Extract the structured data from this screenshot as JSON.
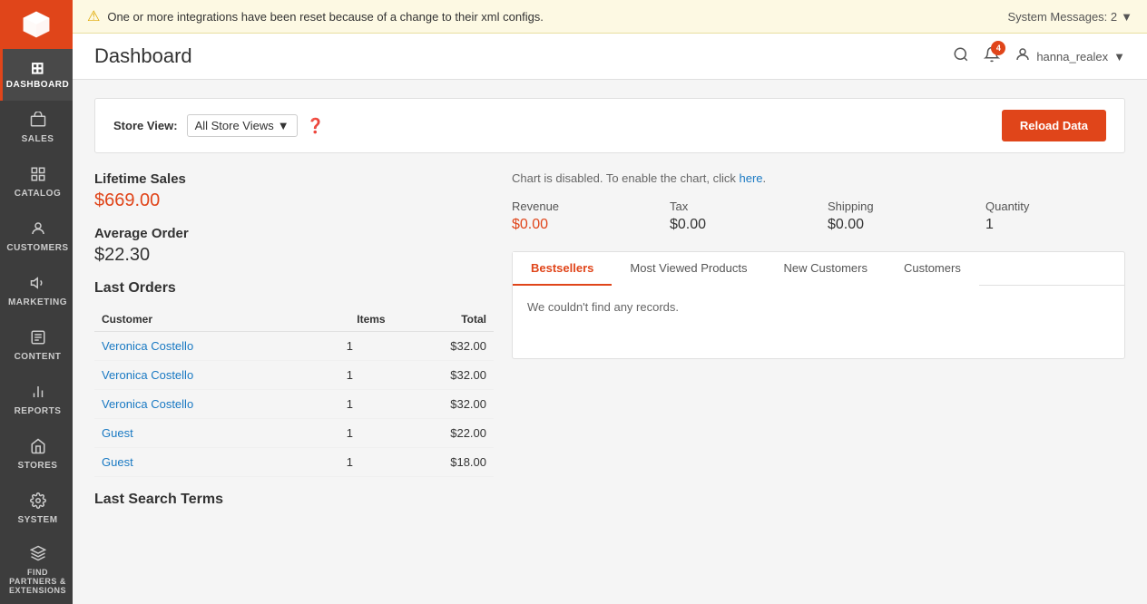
{
  "sidebar": {
    "logo_alt": "Magento Logo",
    "items": [
      {
        "id": "dashboard",
        "label": "DASHBOARD",
        "icon": "⊞",
        "active": true
      },
      {
        "id": "sales",
        "label": "SALES",
        "icon": "🏷"
      },
      {
        "id": "catalog",
        "label": "CATALOG",
        "icon": "📦"
      },
      {
        "id": "customers",
        "label": "CUSTOMERS",
        "icon": "👤"
      },
      {
        "id": "marketing",
        "label": "MARKETING",
        "icon": "📢"
      },
      {
        "id": "content",
        "label": "CONTENT",
        "icon": "📄"
      },
      {
        "id": "reports",
        "label": "REPORTS",
        "icon": "📊"
      },
      {
        "id": "stores",
        "label": "STORES",
        "icon": "🏪"
      },
      {
        "id": "system",
        "label": "SYSTEM",
        "icon": "⚙"
      },
      {
        "id": "find-partners",
        "label": "FIND PARTNERS & EXTENSIONS",
        "icon": "🔌"
      }
    ]
  },
  "alert": {
    "message_prefix": "One or more ",
    "link_text": "integrations",
    "message_suffix": " have been reset because of a change to their xml configs.",
    "system_messages_label": "System Messages: 2"
  },
  "header": {
    "title": "Dashboard",
    "notification_count": "4",
    "user_name": "hanna_realex"
  },
  "store_view": {
    "label": "Store View:",
    "selected": "All Store Views",
    "reload_button": "Reload Data"
  },
  "metrics": {
    "lifetime_sales_label": "Lifetime Sales",
    "lifetime_sales_value": "$669.00",
    "average_order_label": "Average Order",
    "average_order_value": "$22.30"
  },
  "chart": {
    "disabled_message_prefix": "Chart is disabled. To enable the chart, click ",
    "disabled_link": "here",
    "disabled_message_suffix": "."
  },
  "stats": [
    {
      "label": "Revenue",
      "value": "$0.00",
      "orange": true
    },
    {
      "label": "Tax",
      "value": "$0.00",
      "orange": false
    },
    {
      "label": "Shipping",
      "value": "$0.00",
      "orange": false
    },
    {
      "label": "Quantity",
      "value": "1",
      "orange": false
    }
  ],
  "tabs": [
    {
      "id": "bestsellers",
      "label": "Bestsellers",
      "active": true
    },
    {
      "id": "most-viewed",
      "label": "Most Viewed Products",
      "active": false
    },
    {
      "id": "new-customers",
      "label": "New Customers",
      "active": false
    },
    {
      "id": "customers",
      "label": "Customers",
      "active": false
    }
  ],
  "tab_content": {
    "empty_message": "We couldn't find any records."
  },
  "last_orders": {
    "title": "Last Orders",
    "columns": [
      "Customer",
      "Items",
      "Total"
    ],
    "rows": [
      {
        "customer": "Veronica Costello",
        "items": "1",
        "total": "$32.00"
      },
      {
        "customer": "Veronica Costello",
        "items": "1",
        "total": "$32.00"
      },
      {
        "customer": "Veronica Costello",
        "items": "1",
        "total": "$32.00"
      },
      {
        "customer": "Guest",
        "items": "1",
        "total": "$22.00"
      },
      {
        "customer": "Guest",
        "items": "1",
        "total": "$18.00"
      }
    ]
  },
  "last_search_terms": {
    "title": "Last Search Terms"
  }
}
